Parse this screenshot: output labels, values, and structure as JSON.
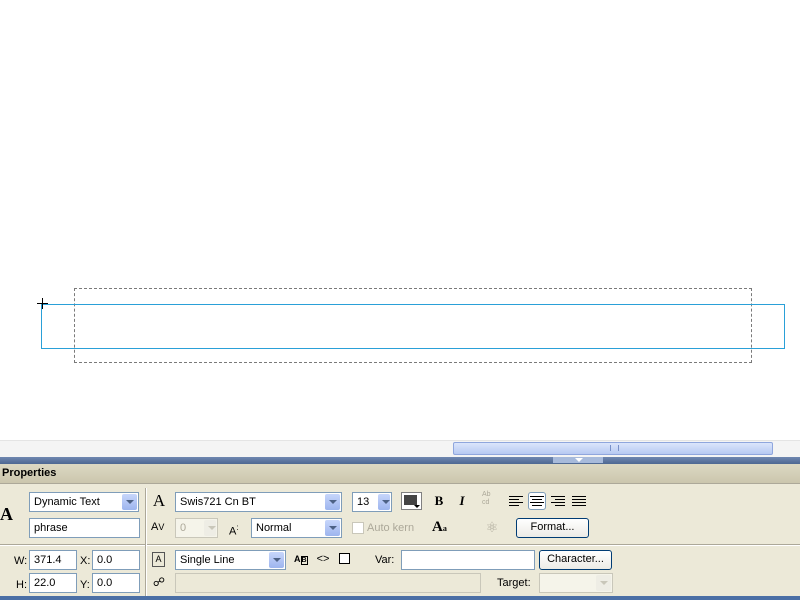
{
  "properties": {
    "title": "Properties",
    "text_type": "Dynamic Text",
    "instance_name": "phrase",
    "width_label": "W:",
    "width_value": "371.4",
    "height_label": "H:",
    "height_value": "22.0",
    "x_label": "X:",
    "x_value": "0.0",
    "y_label": "Y:",
    "y_value": "0.0",
    "font_name": "Swis721 Cn BT",
    "font_size": "13",
    "text_color": "#444444",
    "bold_label": "B",
    "italic_label": "I",
    "letter_spacing": "0",
    "char_position": "Normal",
    "auto_kern_label": "Auto kern",
    "format_button": "Format...",
    "line_type": "Single Line",
    "var_label": "Var:",
    "var_value": "",
    "character_button": "Character...",
    "url_value": "",
    "target_label": "Target:",
    "target_value": ""
  },
  "icons": {
    "text_tool": "text-tool-icon",
    "font": "font-icon",
    "letter_spacing": "letter-spacing-icon",
    "char_position": "char-position-icon",
    "rotate_text": "rotate-text-icon",
    "alias_text": "alias-text-icon",
    "selectable": "selectable-icon",
    "render_html": "render-html-icon",
    "show_border": "show-border-icon",
    "edit_format": "edit-format-icon",
    "link": "link-icon",
    "line_type": "line-type-icon"
  },
  "colors": {
    "panel_bg": "#ece9d8",
    "field_border": "#7f9db9",
    "selection_blue": "#2aa0d8",
    "divider_blue": "#4d6792"
  }
}
